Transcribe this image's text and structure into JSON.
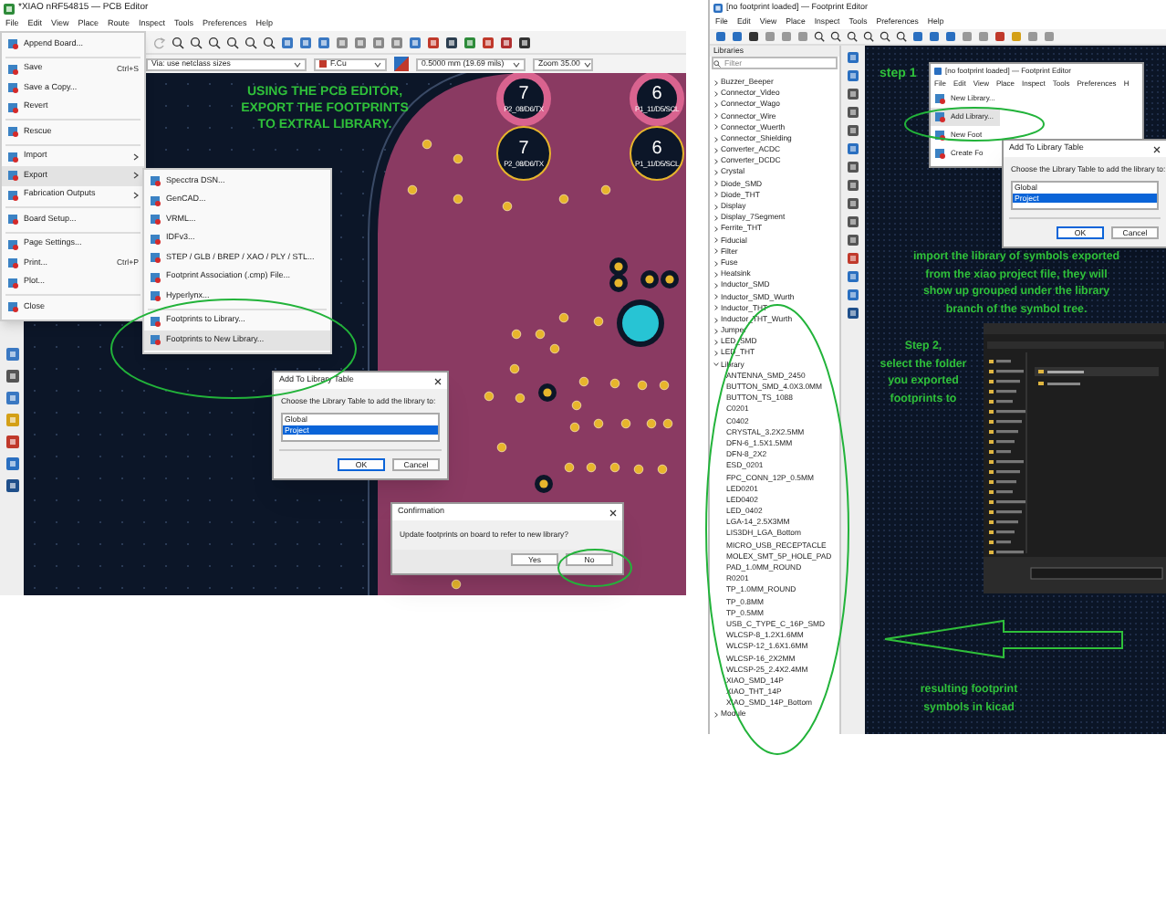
{
  "pcb_editor": {
    "title": "*XIAO nRF54815 — PCB Editor",
    "menu": [
      "File",
      "Edit",
      "View",
      "Place",
      "Route",
      "Inspect",
      "Tools",
      "Preferences",
      "Help"
    ],
    "via_size": "Via: use netclass sizes",
    "layer": "F.Cu",
    "grid": "0.5000 mm (19.69 mils)",
    "zoom": "Zoom 35.00",
    "annotation": "USING THE PCB EDITOR,\nEXPORT THE FOOTPRINTS\nTO EXTRAL LIBRARY.",
    "pads": [
      {
        "number": "7",
        "label": "P2_08/D6/TX",
        "plated": true
      },
      {
        "number": "6",
        "label": "P1_11/D5/SCL",
        "plated": true
      },
      {
        "number": "7",
        "label": "P2_08/D6/TX",
        "plated": false
      },
      {
        "number": "6",
        "label": "P1_11/D5/SCL",
        "plated": false
      }
    ],
    "file_menu": [
      {
        "label": "Append Board...",
        "highlighted": false,
        "submenu": false,
        "divider_after": true
      },
      {
        "label": "Save",
        "shortcut": "Ctrl+S",
        "highlighted": false,
        "submenu": false,
        "divider_after": false
      },
      {
        "label": "Save a Copy...",
        "highlighted": false,
        "submenu": false,
        "divider_after": false
      },
      {
        "label": "Revert",
        "highlighted": false,
        "submenu": false,
        "divider_after": true
      },
      {
        "label": "Rescue",
        "highlighted": false,
        "submenu": false,
        "divider_after": true
      },
      {
        "label": "Import",
        "highlighted": false,
        "submenu": true,
        "divider_after": false
      },
      {
        "label": "Export",
        "highlighted": true,
        "submenu": true,
        "divider_after": false
      },
      {
        "label": "Fabrication Outputs",
        "highlighted": false,
        "submenu": true,
        "divider_after": true
      },
      {
        "label": "Board Setup...",
        "highlighted": false,
        "submenu": false,
        "divider_after": true
      },
      {
        "label": "Page Settings...",
        "highlighted": false,
        "submenu": false,
        "divider_after": false
      },
      {
        "label": "Print...",
        "shortcut": "Ctrl+P",
        "highlighted": false,
        "submenu": false,
        "divider_after": false
      },
      {
        "label": "Plot...",
        "highlighted": false,
        "submenu": false,
        "divider_after": true
      },
      {
        "label": "Close",
        "highlighted": false,
        "submenu": false,
        "divider_after": false
      }
    ],
    "export_menu": [
      {
        "label": "Specctra DSN...",
        "highlighted": false,
        "divider_after": false
      },
      {
        "label": "GenCAD...",
        "highlighted": false,
        "divider_after": false
      },
      {
        "label": "VRML...",
        "highlighted": false,
        "divider_after": false
      },
      {
        "label": "IDFv3...",
        "highlighted": false,
        "divider_after": false
      },
      {
        "label": "STEP / GLB / BREP / XAO / PLY / STL...",
        "highlighted": false,
        "divider_after": false
      },
      {
        "label": "Footprint Association (.cmp) File...",
        "highlighted": false,
        "divider_after": false
      },
      {
        "label": "Hyperlynx...",
        "highlighted": false,
        "divider_after": true
      },
      {
        "label": "Footprints to Library...",
        "highlighted": false,
        "divider_after": false
      },
      {
        "label": "Footprints to New Library...",
        "highlighted": true,
        "divider_after": false
      }
    ],
    "add_library_dialog": {
      "title": "Add To Library Table",
      "prompt": "Choose the Library Table to add the library to:",
      "options": [
        {
          "label": "Global",
          "selected": false
        },
        {
          "label": "Project",
          "selected": true
        }
      ],
      "buttons": [
        {
          "label": "OK",
          "default": true
        },
        {
          "label": "Cancel",
          "default": false
        }
      ]
    },
    "confirmation": {
      "title": "Confirmation",
      "message": "Update footprints on board to refer to new library?",
      "buttons": [
        "Yes",
        "No"
      ]
    }
  },
  "footprint_editor": {
    "title": "[no footprint loaded] — Footprint Editor",
    "menu": [
      "File",
      "Edit",
      "View",
      "Place",
      "Inspect",
      "Tools",
      "Preferences",
      "Help"
    ],
    "libraries_title": "Libraries",
    "filter_placeholder": "Filter",
    "tree": [
      {
        "label": "Buzzer_Beeper",
        "expanded": false
      },
      {
        "label": "Connector_Video",
        "expanded": false
      },
      {
        "label": "Connector_Wago",
        "expanded": false
      },
      {
        "label": "Connector_Wire",
        "expanded": false
      },
      {
        "label": "Connector_Wuerth",
        "expanded": false
      },
      {
        "label": "Connector_Shielding",
        "expanded": false
      },
      {
        "label": "Converter_ACDC",
        "expanded": false
      },
      {
        "label": "Converter_DCDC",
        "expanded": false
      },
      {
        "label": "Crystal",
        "expanded": false
      },
      {
        "label": "Diode_SMD",
        "expanded": false
      },
      {
        "label": "Diode_THT",
        "expanded": false
      },
      {
        "label": "Display",
        "expanded": false
      },
      {
        "label": "Display_7Segment",
        "expanded": false
      },
      {
        "label": "Ferrite_THT",
        "expanded": false
      },
      {
        "label": "Fiducial",
        "expanded": false
      },
      {
        "label": "Filter",
        "expanded": false
      },
      {
        "label": "Fuse",
        "expanded": false
      },
      {
        "label": "Heatsink",
        "expanded": false
      },
      {
        "label": "Inductor_SMD",
        "expanded": false
      },
      {
        "label": "Inductor_SMD_Wurth",
        "expanded": false
      },
      {
        "label": "Inductor_THT",
        "expanded": false
      },
      {
        "label": "Inductor_THT_Wurth",
        "expanded": false
      },
      {
        "label": "Jumper",
        "expanded": false
      },
      {
        "label": "LED_SMD",
        "expanded": false
      },
      {
        "label": "LED_THT",
        "expanded": false
      },
      {
        "label": "Library",
        "expanded": true,
        "children": [
          {
            "label": "ANTENNA_SMD_2450"
          },
          {
            "label": "BUTTON_SMD_4.0X3.0MM"
          },
          {
            "label": "BUTTON_TS_1088"
          },
          {
            "label": "C0201"
          },
          {
            "label": "C0402"
          },
          {
            "label": "CRYSTAL_3.2X2.5MM"
          },
          {
            "label": "DFN-6_1.5X1.5MM"
          },
          {
            "label": "DFN-8_2X2"
          },
          {
            "label": "ESD_0201"
          },
          {
            "label": "FPC_CONN_12P_0.5MM"
          },
          {
            "label": "LED0201"
          },
          {
            "label": "LED0402"
          },
          {
            "label": "LED_0402"
          },
          {
            "label": "LGA-14_2.5X3MM"
          },
          {
            "label": "LIS3DH_LGA_Bottom"
          },
          {
            "label": "MICRO_USB_RECEPTACLE"
          },
          {
            "label": "MOLEX_SMT_5P_HOLE_PAD"
          },
          {
            "label": "PAD_1.0MM_ROUND"
          },
          {
            "label": "R0201"
          },
          {
            "label": "TP_1.0MM_ROUND"
          },
          {
            "label": "TP_0.8MM"
          },
          {
            "label": "TP_0.5MM"
          },
          {
            "label": "USB_C_TYPE_C_16P_SMD"
          },
          {
            "label": "WLCSP-8_1.2X1.6MM"
          },
          {
            "label": "WLCSP-12_1.6X1.6MM"
          },
          {
            "label": "WLCSP-16_2X2MM"
          },
          {
            "label": "WLCSP-25_2.4X2.4MM"
          },
          {
            "label": "XIAO_SMD_14P"
          },
          {
            "label": "XIAO_THT_14P"
          },
          {
            "label": "XIAO_SMD_14P_Bottom"
          }
        ]
      },
      {
        "label": "Module",
        "expanded": false
      }
    ],
    "step1": "step 1",
    "inset_window": {
      "title": "[no footprint loaded] — Footprint Editor",
      "menu": [
        "File",
        "Edit",
        "View",
        "Place",
        "Inspect",
        "Tools",
        "Preferences",
        "H"
      ],
      "items": [
        {
          "label": "New Library...",
          "highlighted": false
        },
        {
          "label": "Add Library...",
          "highlighted": true
        },
        {
          "label": "New Foot",
          "highlighted": false
        },
        {
          "label": "Create Fo",
          "highlighted": false
        }
      ]
    },
    "inset_dialog": {
      "title": "Add To Library Table",
      "prompt": "Choose the Library Table to add the library to:",
      "options": [
        {
          "label": "Global",
          "selected": false
        },
        {
          "label": "Project",
          "selected": true
        }
      ],
      "buttons": [
        {
          "label": "OK",
          "default": true
        },
        {
          "label": "Cancel",
          "default": false
        }
      ]
    },
    "import_note": "import the library of symbols exported\nfrom the xiao project file, they will\nshow up grouped under the library\nbranch of the symbol tree.",
    "step2": "Step 2,\nselect the folder\nyou exported\nfootprints to",
    "result_note": "resulting footprint\nsymbols in kicad"
  }
}
